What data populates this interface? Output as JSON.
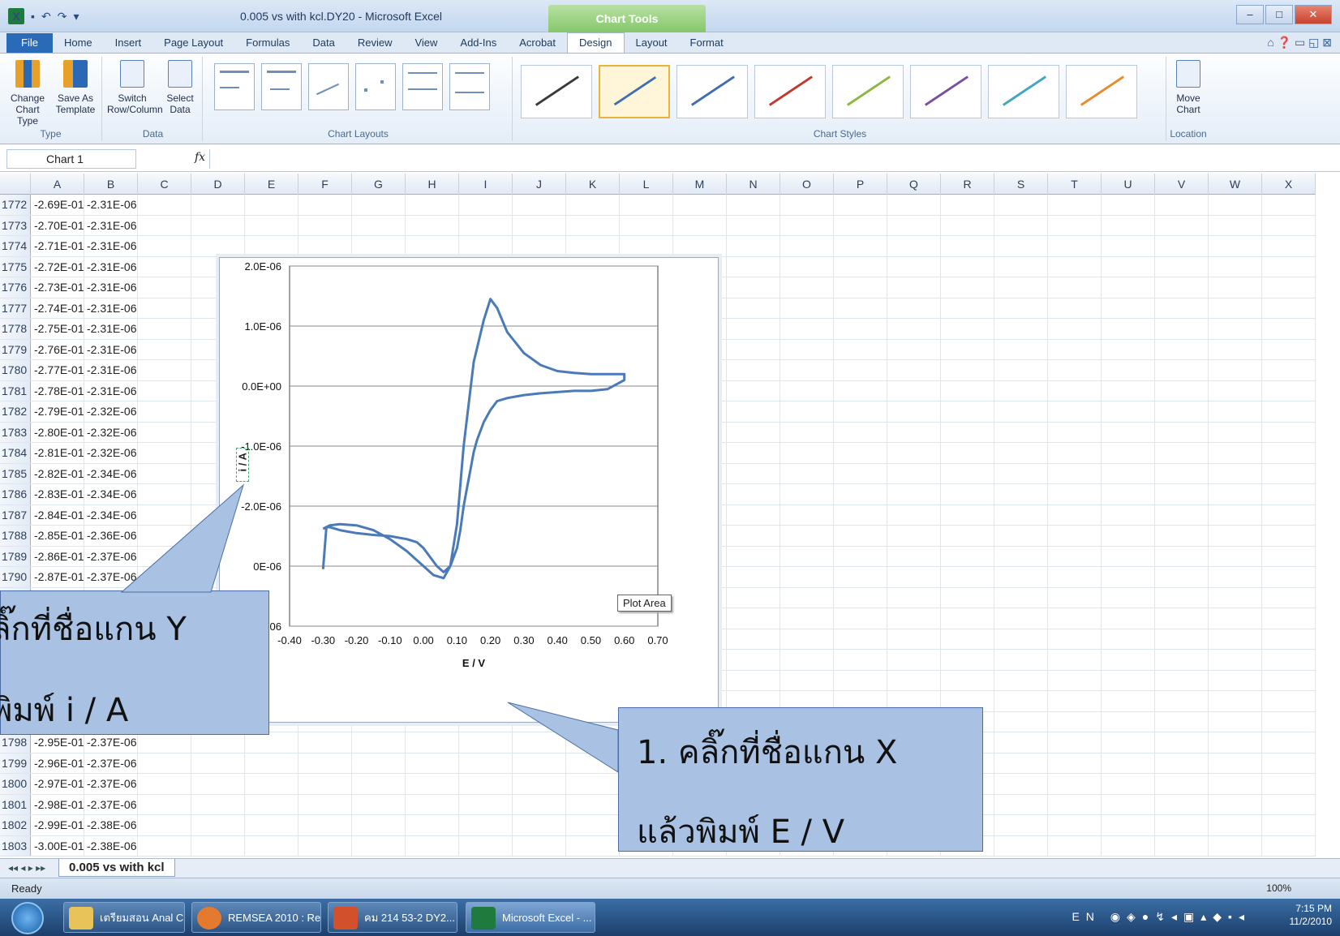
{
  "window": {
    "title": "0.005 vs with kcl.DY20  -  Microsoft Excel",
    "chart_tools": "Chart Tools"
  },
  "tabs": [
    "File",
    "Home",
    "Insert",
    "Page Layout",
    "Formulas",
    "Data",
    "Review",
    "View",
    "Add-Ins",
    "Acrobat",
    "Design",
    "Layout",
    "Format"
  ],
  "active_tab": "Design",
  "ribbon": {
    "type_group": {
      "label": "Type",
      "change": "Change\nChart Type",
      "save": "Save As\nTemplate"
    },
    "data_group": {
      "label": "Data",
      "switch": "Switch\nRow/Column",
      "select": "Select\nData"
    },
    "layouts_label": "Chart Layouts",
    "styles_label": "Chart Styles",
    "style_colors": [
      "#3a3a3a",
      "#3f6fb0",
      "#3f6fb0",
      "#c0392b",
      "#8cb83e",
      "#7a4fa1",
      "#3fa6c4",
      "#e88a2e"
    ],
    "location_group": {
      "label": "Location",
      "move": "Move\nChart"
    }
  },
  "formula_bar": {
    "name_box": "Chart 1",
    "fx": "fx",
    "value": ""
  },
  "columns": [
    "A",
    "B",
    "C",
    "D",
    "E",
    "F",
    "G",
    "H",
    "I",
    "J",
    "K",
    "L",
    "M",
    "N",
    "O",
    "P",
    "Q",
    "R",
    "S",
    "T",
    "U",
    "V",
    "W",
    "X"
  ],
  "rows": [
    {
      "n": "1772",
      "a": "-2.69E-01",
      "b": "-2.31E-06"
    },
    {
      "n": "1773",
      "a": "-2.70E-01",
      "b": "-2.31E-06"
    },
    {
      "n": "1774",
      "a": "-2.71E-01",
      "b": "-2.31E-06"
    },
    {
      "n": "1775",
      "a": "-2.72E-01",
      "b": "-2.31E-06"
    },
    {
      "n": "1776",
      "a": "-2.73E-01",
      "b": "-2.31E-06"
    },
    {
      "n": "1777",
      "a": "-2.74E-01",
      "b": "-2.31E-06"
    },
    {
      "n": "1778",
      "a": "-2.75E-01",
      "b": "-2.31E-06"
    },
    {
      "n": "1779",
      "a": "-2.76E-01",
      "b": "-2.31E-06"
    },
    {
      "n": "1780",
      "a": "-2.77E-01",
      "b": "-2.31E-06"
    },
    {
      "n": "1781",
      "a": "-2.78E-01",
      "b": "-2.31E-06"
    },
    {
      "n": "1782",
      "a": "-2.79E-01",
      "b": "-2.32E-06"
    },
    {
      "n": "1783",
      "a": "-2.80E-01",
      "b": "-2.32E-06"
    },
    {
      "n": "1784",
      "a": "-2.81E-01",
      "b": "-2.32E-06"
    },
    {
      "n": "1785",
      "a": "-2.82E-01",
      "b": "-2.34E-06"
    },
    {
      "n": "1786",
      "a": "-2.83E-01",
      "b": "-2.34E-06"
    },
    {
      "n": "1787",
      "a": "-2.84E-01",
      "b": "-2.34E-06"
    },
    {
      "n": "1788",
      "a": "-2.85E-01",
      "b": "-2.36E-06"
    },
    {
      "n": "1789",
      "a": "-2.86E-01",
      "b": "-2.37E-06"
    },
    {
      "n": "1790",
      "a": "-2.87E-01",
      "b": "-2.37E-06"
    },
    {
      "n": "",
      "a": "",
      "b": ""
    },
    {
      "n": "",
      "a": "",
      "b": ""
    },
    {
      "n": "",
      "a": "",
      "b": ""
    },
    {
      "n": "",
      "a": "",
      "b": ""
    },
    {
      "n": "",
      "a": "",
      "b": ""
    },
    {
      "n": "",
      "a": "",
      "b": ""
    },
    {
      "n": "",
      "a": "",
      "b": ""
    },
    {
      "n": "1798",
      "a": "-2.95E-01",
      "b": "-2.37E-06"
    },
    {
      "n": "1799",
      "a": "-2.96E-01",
      "b": "-2.37E-06"
    },
    {
      "n": "1800",
      "a": "-2.97E-01",
      "b": "-2.37E-06"
    },
    {
      "n": "1801",
      "a": "-2.98E-01",
      "b": "-2.37E-06"
    },
    {
      "n": "1802",
      "a": "-2.99E-01",
      "b": "-2.38E-06"
    },
    {
      "n": "1803",
      "a": "-3.00E-01",
      "b": "-2.38E-06"
    }
  ],
  "chart_data": {
    "type": "scatter",
    "title": "",
    "xlabel": "E / V",
    "ylabel": "i / A",
    "xlim": [
      -0.4,
      0.7
    ],
    "ylim": [
      -4e-06,
      2e-06
    ],
    "x_ticks": [
      "-0.40",
      "-0.30",
      "-0.20",
      "-0.10",
      "0.00",
      "0.10",
      "0.20",
      "0.30",
      "0.40",
      "0.50",
      "0.60",
      "0.70"
    ],
    "y_ticks": [
      "2.0E-06",
      "1.0E-06",
      "0.0E+00",
      "-1.0E-06",
      "-2.0E-06",
      "-3.0E-06",
      "-4.0E-06"
    ],
    "y_ticks_visible": [
      "2.0E-06",
      "1.0E-06",
      "0.0E+00",
      "-1.0E-06",
      "-2.0E-06",
      "0E-06",
      "0E-06"
    ],
    "grid": true,
    "series": [
      {
        "x": [
          -0.3,
          -0.28,
          -0.25,
          -0.2,
          -0.15,
          -0.1,
          -0.05,
          0.0,
          0.03,
          0.06,
          0.08,
          0.1,
          0.12,
          0.15,
          0.18,
          0.2,
          0.22,
          0.25,
          0.3,
          0.35,
          0.4,
          0.45,
          0.5,
          0.55,
          0.6,
          0.6,
          0.55,
          0.5,
          0.45,
          0.4,
          0.35,
          0.3,
          0.25,
          0.22,
          0.2,
          0.18,
          0.16,
          0.15,
          0.14,
          0.13,
          0.12,
          0.11,
          0.1,
          0.08,
          0.06,
          0.04,
          0.02,
          0.0,
          -0.02,
          -0.05,
          -0.1,
          -0.15,
          -0.2,
          -0.25,
          -0.28,
          -0.29,
          -0.3
        ],
        "y": [
          -2.38e-06,
          -2.32e-06,
          -2.3e-06,
          -2.32e-06,
          -2.4e-06,
          -2.55e-06,
          -2.75e-06,
          -3e-06,
          -3.15e-06,
          -3.2e-06,
          -3e-06,
          -2.3e-06,
          -1e-06,
          4e-07,
          1.1e-06,
          1.45e-06,
          1.3e-06,
          9e-07,
          5.5e-07,
          3.5e-07,
          2.5e-07,
          2.2e-07,
          2e-07,
          2e-07,
          2e-07,
          1e-07,
          -5e-08,
          -8e-08,
          -8e-08,
          -1e-07,
          -1.2e-07,
          -1.5e-07,
          -2e-07,
          -2.5e-07,
          -4e-07,
          -6e-07,
          -9e-07,
          -1.1e-06,
          -1.4e-06,
          -1.7e-06,
          -2e-06,
          -2.4e-06,
          -2.7e-06,
          -3e-06,
          -3.1e-06,
          -3e-06,
          -2.85e-06,
          -2.7e-06,
          -2.6e-06,
          -2.55e-06,
          -2.5e-06,
          -2.48e-06,
          -2.45e-06,
          -2.4e-06,
          -2.35e-06,
          -2.35e-06,
          -3.05e-06
        ]
      }
    ]
  },
  "plot_area_tooltip": "Plot Area",
  "callouts": {
    "y": [
      "ลิ๊กที่ชื่อแกน Y",
      "พิมพ์ i / A"
    ],
    "x": [
      "1. คลิ๊กที่ชื่อแกน X",
      "แล้วพิมพ์ E / V"
    ]
  },
  "sheet_tab": "0.005 vs with kcl",
  "status": {
    "ready": "Ready",
    "zoom": "100%"
  },
  "taskbar": {
    "items": [
      "เตรียมสอน Anal C...",
      "REMSEA 2010 : Re...",
      "คม 214 53-2 DY2...",
      "Microsoft Excel - ..."
    ],
    "lang": "EN",
    "time": "7:15 PM",
    "date": "11/2/2010"
  }
}
